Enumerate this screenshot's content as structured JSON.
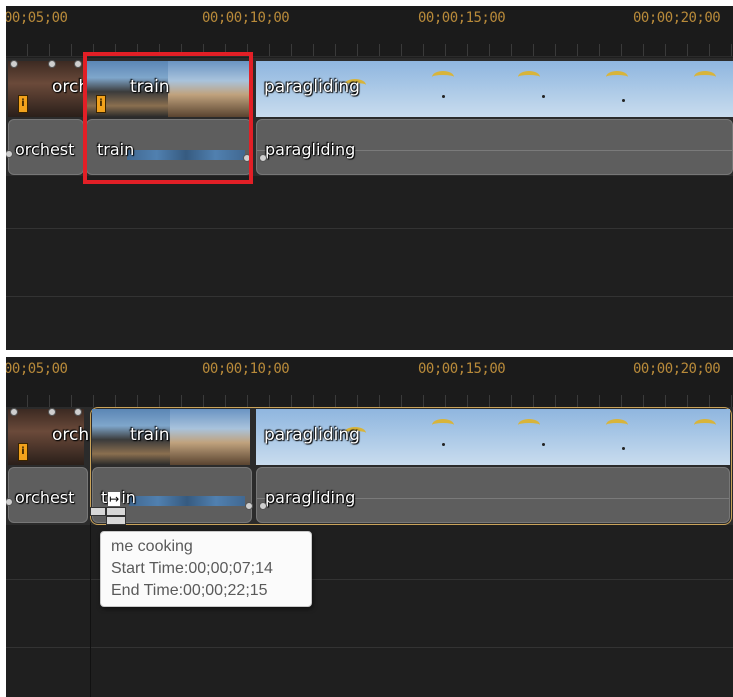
{
  "ruler": {
    "labels": [
      "00;05;00",
      "00;00;10;00",
      "00;00;15;00",
      "00;00;20;00"
    ]
  },
  "top": {
    "video_clips": {
      "orchestra": "orch",
      "train": "train",
      "paragliding": "paragliding"
    },
    "audio_clips": {
      "orchestra": "orchest",
      "train": "train",
      "paragliding": "paragliding"
    }
  },
  "bottom": {
    "video_clips": {
      "orchestra": "orch",
      "train": "train",
      "paragliding": "paragliding"
    },
    "audio_clips": {
      "orchestra": "orchest",
      "train": "t",
      "train_suffix": "in",
      "paragliding": "paragliding"
    },
    "tooltip": {
      "title": "me cooking",
      "start": "Start Time:00;00;07;14",
      "end": "End Time:00;00;22;15"
    }
  },
  "icons": [
    "info-marker-icon",
    "drag-arrow-icon",
    "paraglider-icon"
  ],
  "colors": {
    "ruler_text": "#b88a3a",
    "selection": "#e21f26",
    "video_clip": "#6a8fb8",
    "panel": "#1f1f1f"
  }
}
